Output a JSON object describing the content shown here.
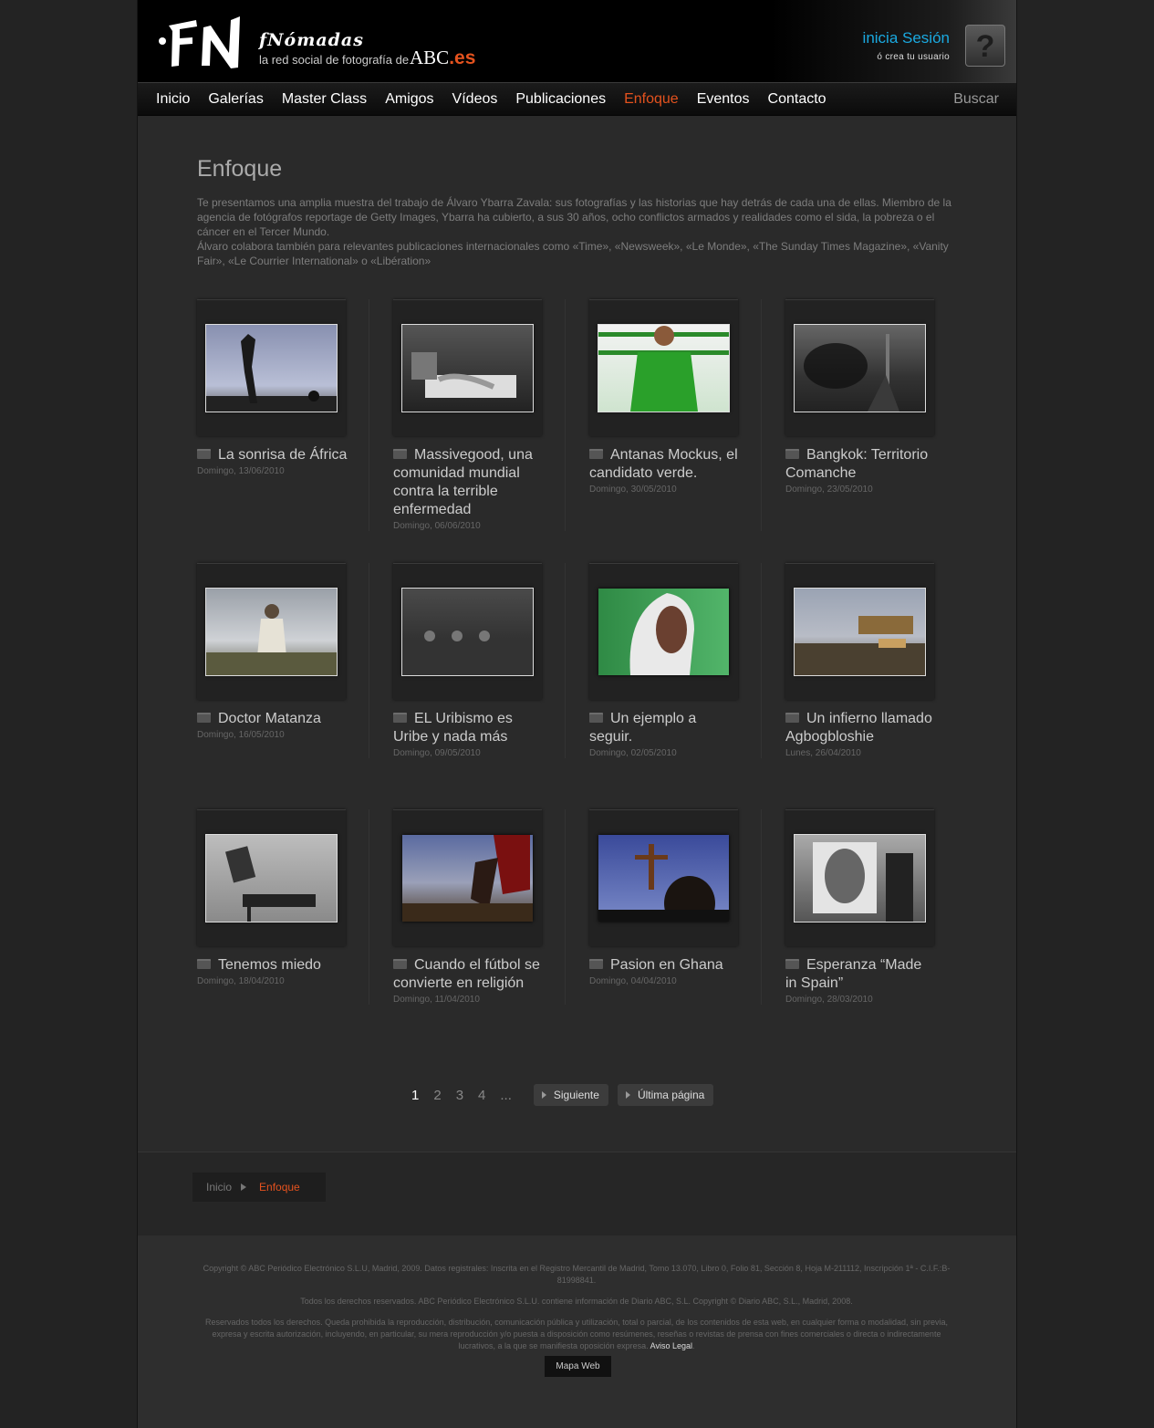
{
  "header": {
    "logo_word": "fNómadas",
    "tagline": "la red social de fotografía de",
    "abc": "ABC",
    "abc_es": ".es",
    "login_label": "inicia Sesión",
    "register_label": "ó crea tu usuario",
    "help_symbol": "?"
  },
  "nav": {
    "items": [
      "Inicio",
      "Galerías",
      "Master Class",
      "Amigos",
      "Vídeos",
      "Publicaciones",
      "Enfoque",
      "Eventos",
      "Contacto"
    ],
    "active": "Enfoque",
    "search": "Buscar"
  },
  "page": {
    "title": "Enfoque",
    "intro_1": "Te presentamos una amplia muestra del trabajo de Álvaro Ybarra Zavala: sus fotografías y las historias que hay detrás de cada una de ellas. Miembro de la agencia de fotógrafos reportage de Getty Images, Ybarra ha cubierto, a sus 30 años, ocho conflictos armados y realidades como el sida, la pobreza o el cáncer en el Tercer Mundo.",
    "intro_2": "Álvaro colabora también para relevantes publicaciones internacionales como «Time», «Newsweek», «Le Monde», «The Sunday Times Magazine», «Vanity Fair», «Le Courrier International» o «Libération»"
  },
  "articles": [
    {
      "title": "La sonrisa de África",
      "date": "Domingo, 13/06/2010",
      "thumb": "sky-figure"
    },
    {
      "title": "Massivegood, una comunidad mundial contra la terrible enfermedad",
      "date": "Domingo, 06/06/2010",
      "thumb": "hospital-bed"
    },
    {
      "title": "Antanas Mockus, el candidato verde.",
      "date": "Domingo, 30/05/2010",
      "thumb": "green-shirt"
    },
    {
      "title": "Bangkok: Territorio Comanche",
      "date": "Domingo, 23/05/2010",
      "thumb": "smoke-street"
    },
    {
      "title": "Doctor Matanza",
      "date": "Domingo, 16/05/2010",
      "thumb": "uniformed-man"
    },
    {
      "title": "EL Uribismo es Uribe y nada más",
      "date": "Domingo, 09/05/2010",
      "thumb": "dark-room"
    },
    {
      "title": "Un ejemplo a seguir.",
      "date": "Domingo, 02/05/2010",
      "thumb": "woman-green"
    },
    {
      "title": "Un infierno llamado Agbogbloshie",
      "date": "Lunes, 26/04/2010",
      "thumb": "dump-site"
    },
    {
      "title": "Tenemos miedo",
      "date": "Domingo, 18/04/2010",
      "thumb": "wall-posters"
    },
    {
      "title": "Cuando el fútbol se convierte en religión",
      "date": "Domingo, 11/04/2010",
      "thumb": "football"
    },
    {
      "title": "Pasion en Ghana",
      "date": "Domingo, 04/04/2010",
      "thumb": "crucifix"
    },
    {
      "title": "Esperanza “Made in Spain”",
      "date": "Domingo, 28/03/2010",
      "thumb": "xray"
    }
  ],
  "pagination": {
    "pages": [
      "1",
      "2",
      "3",
      "4",
      "..."
    ],
    "current": "1",
    "next": "Siguiente",
    "last": "Última página"
  },
  "breadcrumb": {
    "home": "Inicio",
    "current": "Enfoque"
  },
  "footer": {
    "copyright": "Copyright © ABC Periódico Electrónico S.L.U, Madrid, 2009. Datos registrales: Inscrita en el Registro Mercantil de Madrid, Tomo 13.070, Libro 0, Folio 81, Sección 8, Hoja M-211112, Inscripción 1ª - C.I.F.:B-81998841.",
    "rights": "Todos los derechos reservados. ABC Periódico Electrónico S.L.U. contiene información de Diario ABC, S.L. Copyright © Diario ABC, S.L., Madrid, 2008.",
    "legal": "Reservados todos los derechos. Queda prohibida la reproducción, distribución, comunicación pública y utilización, total o parcial, de los contenidos de esta web, en cualquier forma o modalidad, sin previa, expresa y escrita autorización, incluyendo, en particular, su mera reproducción y/o puesta a disposición como resúmenes, reseñas o revistas de prensa con fines comerciales o directa o indirectamente lucrativos, a la que se manifiesta oposición expresa.",
    "aviso": "Aviso Legal",
    "sitemap": "Mapa Web"
  },
  "colors": {
    "accent": "#e4521e",
    "login": "#1aa9e0",
    "background": "#2a2a2a"
  }
}
